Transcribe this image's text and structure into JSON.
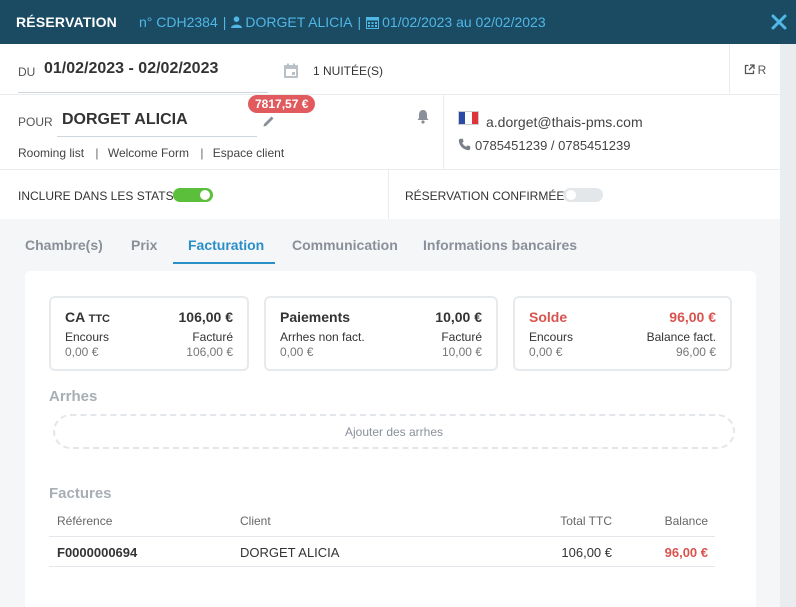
{
  "header": {
    "title": "RÉSERVATION",
    "ref": "n° CDH2384",
    "guest": "DORGET ALICIA",
    "dates": "01/02/2023 au 02/02/2023"
  },
  "stay": {
    "du_label": "DU",
    "dates": "01/02/2023 - 02/02/2023",
    "nights": "1 NUITÉE(S)",
    "r_label": "R"
  },
  "guest": {
    "pour_label": "POUR",
    "name": "DORGET ALICIA",
    "balance_badge": "7817,57 €",
    "links": [
      "Rooming list",
      "Welcome Form",
      "Espace client"
    ],
    "email": "a.dorget@thais-pms.com",
    "phones": "0785451239 / 0785451239"
  },
  "options": {
    "stats_label": "INCLURE DANS LES STATS",
    "stats_on": true,
    "confirmed_label": "RÉSERVATION CONFIRMÉE",
    "confirmed_on": false
  },
  "tabs": [
    {
      "label": "Chambre(s)"
    },
    {
      "label": "Prix"
    },
    {
      "label": "Facturation",
      "active": true
    },
    {
      "label": "Communication"
    },
    {
      "label": "Informations bancaires"
    }
  ],
  "summary": {
    "ca": {
      "title": "CA",
      "suffix": "TTC",
      "value": "106,00 €",
      "l_label": "Encours",
      "l_value": "0,00 €",
      "r_label": "Facturé",
      "r_value": "106,00 €"
    },
    "paiements": {
      "title": "Paiements",
      "value": "10,00 €",
      "l_label": "Arrhes non fact.",
      "l_value": "0,00 €",
      "r_label": "Facturé",
      "r_value": "10,00 €"
    },
    "solde": {
      "title": "Solde",
      "value": "96,00 €",
      "l_label": "Encours",
      "l_value": "0,00 €",
      "r_label": "Balance fact.",
      "r_value": "96,00 €"
    }
  },
  "arrhes": {
    "title": "Arrhes",
    "add_label": "Ajouter des arrhes"
  },
  "factures": {
    "title": "Factures",
    "columns": [
      "Référence",
      "Client",
      "Total TTC",
      "Balance"
    ],
    "rows": [
      {
        "ref": "F0000000694",
        "client": "DORGET ALICIA",
        "total": "106,00 €",
        "balance": "96,00 €"
      }
    ]
  },
  "colors": {
    "header_bg": "#1b4a63",
    "accent": "#2a8fc7",
    "danger": "#d9534f",
    "toggle_on": "#5cbf3c"
  }
}
